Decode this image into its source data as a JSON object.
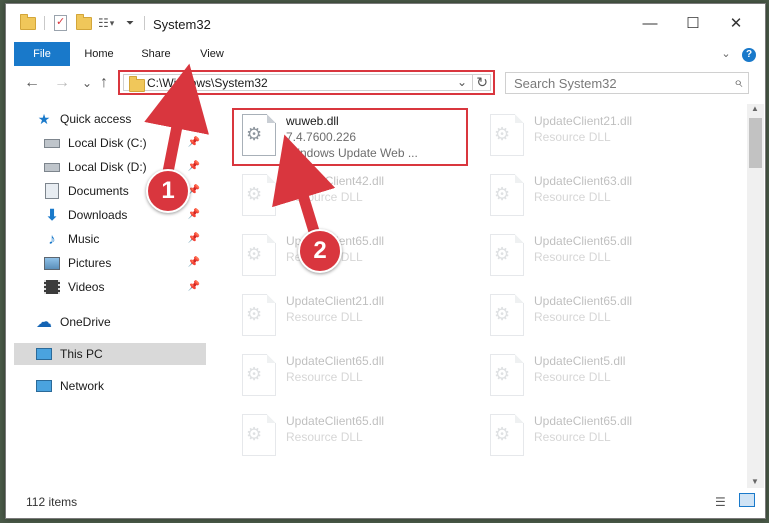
{
  "window": {
    "title": "System32",
    "minimize": "—",
    "maximize": "☐",
    "close": "✕"
  },
  "ribbon": {
    "tabs": [
      "File",
      "Home",
      "Share",
      "View"
    ],
    "collapse": "⌄",
    "help": "?"
  },
  "nav_buttons": {
    "back": "←",
    "forward": "→",
    "recent": "⌄",
    "up": "↑"
  },
  "address": {
    "path": "C:\\Windows\\System32",
    "dropdown": "⌄",
    "refresh": "↻"
  },
  "search": {
    "placeholder": "Search System32",
    "icon": "⌕"
  },
  "sidebar": {
    "items": [
      {
        "label": "Quick access",
        "icon": "star-icon",
        "pinned": false
      },
      {
        "label": "Local Disk (C:)",
        "icon": "drive-icon",
        "pinned": true
      },
      {
        "label": "Local Disk (D:)",
        "icon": "drive-icon",
        "pinned": true
      },
      {
        "label": "Documents",
        "icon": "documents-icon",
        "pinned": true
      },
      {
        "label": "Downloads",
        "icon": "downloads-icon",
        "pinned": true
      },
      {
        "label": "Music",
        "icon": "music-icon",
        "pinned": true
      },
      {
        "label": "Pictures",
        "icon": "pictures-icon",
        "pinned": true
      },
      {
        "label": "Videos",
        "icon": "videos-icon",
        "pinned": true
      },
      {
        "label": "OneDrive",
        "icon": "onedrive-icon",
        "pinned": false
      },
      {
        "label": "This PC",
        "icon": "pc-icon",
        "pinned": false,
        "selected": true
      },
      {
        "label": "Network",
        "icon": "network-icon",
        "pinned": false
      }
    ]
  },
  "files": [
    {
      "name": "wuweb.dll",
      "line1": "7.4.7600.226",
      "line2": "Windows Update Web ...",
      "highlighted": true
    },
    {
      "name": "UpdateClient21.dll",
      "line1": "Resource DLL",
      "line2": ""
    },
    {
      "name": "UpdateClient42.dll",
      "line1": "Resource DLL",
      "line2": ""
    },
    {
      "name": "UpdateClient63.dll",
      "line1": "Resource DLL",
      "line2": ""
    },
    {
      "name": "UpdateClient65.dll",
      "line1": "Resource DLL",
      "line2": ""
    },
    {
      "name": "UpdateClient65.dll",
      "line1": "Resource DLL",
      "line2": ""
    },
    {
      "name": "UpdateClient21.dll",
      "line1": "Resource DLL",
      "line2": ""
    },
    {
      "name": "UpdateClient65.dll",
      "line1": "Resource DLL",
      "line2": ""
    },
    {
      "name": "UpdateClient65.dll",
      "line1": "Resource DLL",
      "line2": ""
    },
    {
      "name": "UpdateClient5.dll",
      "line1": "Resource DLL",
      "line2": ""
    },
    {
      "name": "UpdateClient65.dll",
      "line1": "Resource DLL",
      "line2": ""
    },
    {
      "name": "UpdateClient65.dll",
      "line1": "Resource DLL",
      "line2": ""
    }
  ],
  "status": {
    "count": "112 items"
  },
  "annotations": {
    "step1": "1",
    "step2": "2"
  },
  "colors": {
    "accent": "#1979ca",
    "annotation": "#d9363e",
    "selection": "#d9d9d9"
  }
}
